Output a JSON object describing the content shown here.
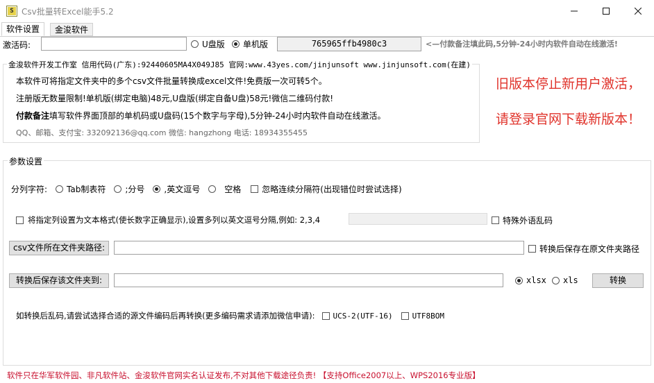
{
  "window": {
    "title": "Csv批量转Excel能手5.2",
    "icon_glyph": "S",
    "buttons": [
      "minimize-icon",
      "maximize-icon",
      "close-icon"
    ]
  },
  "tabs": [
    {
      "label": "软件设置",
      "active": true
    },
    {
      "label": "金浚软件",
      "active": false
    }
  ],
  "activation": {
    "label": "激活码:",
    "input_value": "",
    "radio_u": "U盘版",
    "radio_single": "单机版",
    "selected": "单机版",
    "machine_code": "765965ffb4980c3",
    "hint": "<—付款备注填此码,5分钟-24小时内软件自动在线激活!"
  },
  "info": {
    "group_title": "金浚软件开发工作室 信用代码(广东):92440605MA4X049J85 官网:www.43yes.com/jinjunsoft  www.jinjunsoft.com(在建)",
    "line1": "本软件可将指定文件夹中的多个csv文件批量转换成excel文件!免费版一次可转5个。",
    "line2": "注册版无数量限制!单机版(绑定电脑)48元,U盘版(绑定自备U盘)58元!微信二维码付款!",
    "line3_bold": "付款备注",
    "line3_rest": "填写软件界面顶部的单机码或U盘码(15个数字与字母),5分钟-24小时内软件自动在线激活。",
    "line4": "QQ、邮箱、支付宝: 332092136@qq.com   微信: hangzhong   电话: 18934355455"
  },
  "notice": {
    "line1": "旧版本停止新用户激活，",
    "line2": "请登录官网下载新版本！",
    "color": "#e0332b"
  },
  "params": {
    "group_title": "参数设置",
    "delimiter_label": "分列字符:",
    "delimiters": [
      {
        "label": "Tab制表符",
        "checked": false
      },
      {
        "label": ";分号",
        "checked": false
      },
      {
        "label": ",英文逗号",
        "checked": true
      },
      {
        "label": "空格",
        "checked": false
      }
    ],
    "ignore_consecutive": "忽略连续分隔符(出现错位时尝试选择)",
    "text_format_label": "将指定列设置为文本格式(使长数字正确显示),设置多列以英文逗号分隔,例如: 2,3,4",
    "text_format_value": "",
    "special_chars": "特殊外语乱码",
    "csv_folder_button": "csv文件所在文件夹路径:",
    "csv_folder_value": "",
    "save_in_source": "转换后保存在原文件夹路径",
    "save_folder_button": "转换后保存该文件夹到:",
    "save_folder_value": "",
    "format_xlsx": "xlsx",
    "format_xls": "xls",
    "format_selected": "xlsx",
    "convert_button": "转换",
    "encoding_hint": "如转换后乱码,请尝试选择合适的源文件编码后再转换(更多编码需求请添加微信申请):",
    "encoding_ucs2": "UCS-2(UTF-16)",
    "encoding_utf8bom": "UTF8BOM"
  },
  "footer": {
    "text": "软件只在华军软件园、非凡软件站、金浚软件官网实名认证发布,不对其他下载途径负责! 【支持Office2007以上、WPS2016专业版】",
    "color": "#c8102e"
  }
}
